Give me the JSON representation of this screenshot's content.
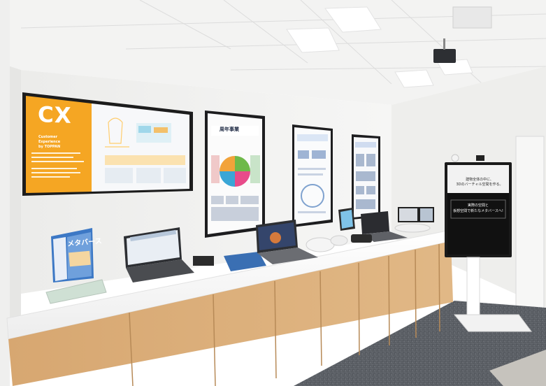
{
  "photo": {
    "colors": {
      "wall": "#f4f4f3",
      "ceiling": "#f1f1f0",
      "counter_top": "#fbfbfb",
      "cabinet_wood": "#dcb17f",
      "carpet": "#55595f",
      "cx_orange": "#f5a623"
    },
    "large_screen": {
      "headline": "CX",
      "tagline_lines": [
        "Customer",
        "Experience",
        "by TOPPAN"
      ]
    },
    "brochure_title": "メタバース",
    "kiosk": {
      "line1": "建物全体の中に、",
      "line2": "3Dのバーチャル空間を作る。",
      "line3": "実際の空間と",
      "line4": "仮想空間で新たなメタバースへ!"
    },
    "display_titles": [
      "周年事業"
    ]
  }
}
